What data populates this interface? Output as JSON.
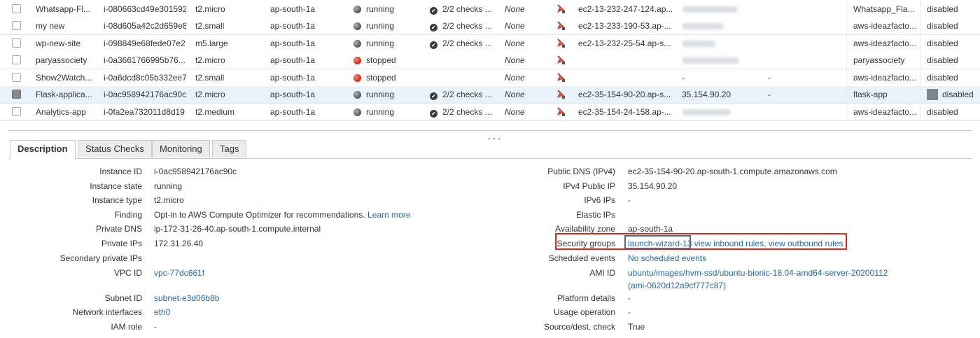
{
  "colors": {
    "link": "#2469a6",
    "highlight": "#e3261b",
    "selected_row": "#e8f2fb"
  },
  "instances": [
    {
      "name": "Whatsapp-Fl...",
      "id": "i-080663cd49e301592",
      "type": "t2.micro",
      "az": "ap-south-1a",
      "state": "running",
      "checks": "2/2 checks ...",
      "alarm": "None",
      "dns": "ec2-13-232-247-124.ap....",
      "ip": "",
      "ipv6": "",
      "key": "Whatsapp_Fla...",
      "monitoring": "disabled"
    },
    {
      "name": "my new",
      "id": "i-08d605a42c2d659e8",
      "type": "t2.small",
      "az": "ap-south-1a",
      "state": "running",
      "checks": "2/2 checks ...",
      "alarm": "None",
      "dns": "ec2-13-233-190-53.ap-...",
      "ip": "",
      "ipv6": "",
      "key": "aws-ideazfacto...",
      "monitoring": "disabled"
    },
    {
      "name": "wp-new-site",
      "id": "i-098849e68fede07e2",
      "type": "m5.large",
      "az": "ap-south-1a",
      "state": "running",
      "checks": "2/2 checks ...",
      "alarm": "None",
      "dns": "ec2-13-232-25-54.ap-s...",
      "ip": "",
      "ipv6": "",
      "key": "aws-ideazfacto...",
      "monitoring": "disabled"
    },
    {
      "name": "paryassociety",
      "id": "i-0a3661766995b76...",
      "type": "t2.micro",
      "az": "ap-south-1a",
      "state": "stopped",
      "checks": "",
      "alarm": "None",
      "dns": "",
      "ip": "",
      "ipv6": "",
      "key": "paryassociety",
      "monitoring": "disabled"
    },
    {
      "name": "Show2Watch...",
      "id": "i-0a6dcd8c05b332ee7",
      "type": "t2.small",
      "az": "ap-south-1a",
      "state": "stopped",
      "checks": "",
      "alarm": "None",
      "dns": "",
      "ip": "-",
      "ipv6": "-",
      "key": "aws-ideazfacto...",
      "monitoring": "disabled"
    },
    {
      "name": "Flask-applica...",
      "id": "i-0ac958942176ac90c",
      "type": "t2.micro",
      "az": "ap-south-1a",
      "state": "running",
      "checks": "2/2 checks ...",
      "alarm": "None",
      "dns": "ec2-35-154-90-20.ap-s...",
      "ip": "35.154.90.20",
      "ipv6": "-",
      "key": "flask-app",
      "monitoring": "disabled",
      "selected": true
    },
    {
      "name": "Analytics-app",
      "id": "i-0fa2ea732011d8d19",
      "type": "t2.medium",
      "az": "ap-south-1a",
      "state": "running",
      "checks": "2/2 checks ...",
      "alarm": "None",
      "dns": "ec2-35-154-24-158.ap-...",
      "ip": "",
      "ipv6": "",
      "key": "aws-ideazfacto...",
      "monitoring": "disabled"
    }
  ],
  "tabs": [
    "Description",
    "Status Checks",
    "Monitoring",
    "Tags"
  ],
  "details_left": [
    {
      "label": "Instance ID",
      "value": "i-0ac958942176ac90c"
    },
    {
      "label": "Instance state",
      "value": "running"
    },
    {
      "label": "Instance type",
      "value": "t2.micro"
    },
    {
      "label": "Finding",
      "value": "Opt-in to AWS Compute Optimizer for recommendations.",
      "link": "Learn more"
    },
    {
      "label": "Private DNS",
      "value": "ip-172-31-26-40.ap-south-1.compute.internal"
    },
    {
      "label": "Private IPs",
      "value": "172.31.26.40"
    },
    {
      "label": "Secondary private IPs",
      "value": ""
    },
    {
      "label": "VPC ID",
      "value": "",
      "link": "vpc-77dc661f"
    },
    {
      "label": "Subnet ID",
      "value": "",
      "link": "subnet-e3d06b8b"
    },
    {
      "label": "Network interfaces",
      "value": "",
      "link": "eth0"
    },
    {
      "label": "IAM role",
      "value": "-"
    }
  ],
  "details_right": [
    {
      "label": "Public DNS (IPv4)",
      "value": "ec2-35-154-90-20.ap-south-1.compute.amazonaws.com"
    },
    {
      "label": "IPv4 Public IP",
      "value": "35.154.90.20"
    },
    {
      "label": "IPv6 IPs",
      "value": "-"
    },
    {
      "label": "Elastic IPs",
      "value": ""
    },
    {
      "label": "Availability zone",
      "value": "ap-south-1a"
    },
    {
      "label": "Security groups",
      "link": "launch-wizard-13",
      "links2": "view inbound rules, view outbound rules"
    },
    {
      "label": "Scheduled events",
      "value": "",
      "link": "No scheduled events"
    },
    {
      "label": "AMI ID",
      "value": "",
      "link": "ubuntu/images/hvm-ssd/ubuntu-bionic-18.04-amd64-server-20200112",
      "link2": "(ami-0620d12a9cf777c87)"
    },
    {
      "label": "Platform details",
      "value": "-"
    },
    {
      "label": "Usage operation",
      "value": "-"
    },
    {
      "label": "Source/dest. check",
      "value": "True"
    }
  ]
}
